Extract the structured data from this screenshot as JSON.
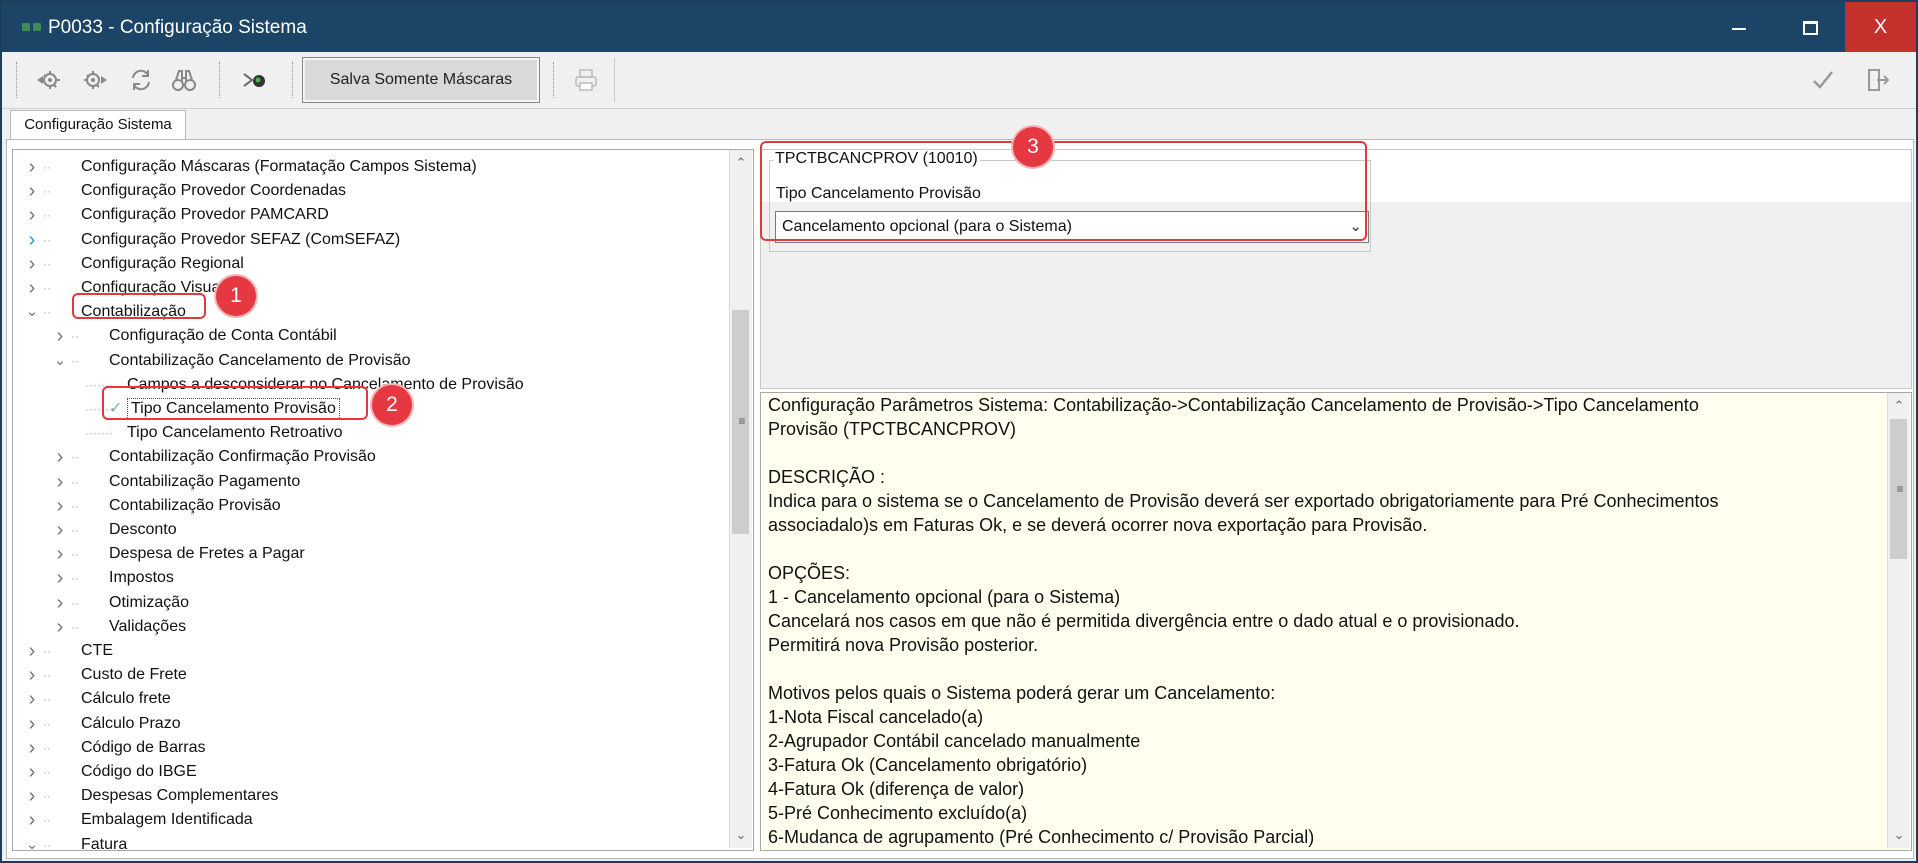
{
  "window": {
    "title": "P0033 - Configuração Sistema",
    "minimize_label": "—",
    "close_label": "X"
  },
  "toolbar": {
    "save_masks_label": "Salva Somente Máscaras"
  },
  "tab": {
    "label": "Configuração Sistema"
  },
  "tree": {
    "rows": [
      {
        "label": "Configuração Máscaras (Formatação Campos Sistema)",
        "level": 0,
        "expander": "collapsed"
      },
      {
        "label": "Configuração Provedor Coordenadas",
        "level": 0,
        "expander": "collapsed"
      },
      {
        "label": "Configuração Provedor PAMCARD",
        "level": 0,
        "expander": "collapsed"
      },
      {
        "label": "Configuração Provedor SEFAZ (ComSEFAZ)",
        "level": 0,
        "expander": "collapsed-blue"
      },
      {
        "label": "Configuração Regional",
        "level": 0,
        "expander": "collapsed"
      },
      {
        "label": "Configuração Visual",
        "level": 0,
        "expander": "collapsed"
      },
      {
        "label": "Contabilização",
        "level": 0,
        "expander": "expanded"
      },
      {
        "label": "Configuração de Conta Contábil",
        "level": 1,
        "expander": "collapsed"
      },
      {
        "label": "Contabilização Cancelamento de Provisão",
        "level": 1,
        "expander": "expanded"
      },
      {
        "label": "Campos a desconsiderar no Cancelamento de Provisão",
        "level": 2,
        "expander": "leaf"
      },
      {
        "label": "Tipo Cancelamento Provisão",
        "level": 2,
        "expander": "leaf-selected"
      },
      {
        "label": "Tipo Cancelamento Retroativo",
        "level": 2,
        "expander": "leaf"
      },
      {
        "label": "Contabilização Confirmação Provisão",
        "level": 1,
        "expander": "collapsed"
      },
      {
        "label": "Contabilização Pagamento",
        "level": 1,
        "expander": "collapsed"
      },
      {
        "label": "Contabilização Provisão",
        "level": 1,
        "expander": "collapsed"
      },
      {
        "label": "Desconto",
        "level": 1,
        "expander": "collapsed"
      },
      {
        "label": "Despesa de Fretes a Pagar",
        "level": 1,
        "expander": "collapsed"
      },
      {
        "label": "Impostos",
        "level": 1,
        "expander": "collapsed"
      },
      {
        "label": "Otimização",
        "level": 1,
        "expander": "collapsed"
      },
      {
        "label": "Validações",
        "level": 1,
        "expander": "collapsed"
      },
      {
        "label": "CTE",
        "level": 0,
        "expander": "collapsed"
      },
      {
        "label": "Custo de Frete",
        "level": 0,
        "expander": "collapsed"
      },
      {
        "label": "Cálculo frete",
        "level": 0,
        "expander": "collapsed"
      },
      {
        "label": "Cálculo Prazo",
        "level": 0,
        "expander": "collapsed"
      },
      {
        "label": "Código de Barras",
        "level": 0,
        "expander": "collapsed"
      },
      {
        "label": "Código do IBGE",
        "level": 0,
        "expander": "collapsed"
      },
      {
        "label": "Despesas Complementares",
        "level": 0,
        "expander": "collapsed"
      },
      {
        "label": "Embalagem Identificada",
        "level": 0,
        "expander": "collapsed"
      },
      {
        "label": "Fatura",
        "level": 0,
        "expander": "expanded"
      }
    ]
  },
  "annotations": {
    "badge1": "1",
    "badge2": "2",
    "badge3": "3"
  },
  "param": {
    "code": "TPCTBCANCPROV (10010)",
    "label": "Tipo Cancelamento Provisão",
    "selected_value": "Cancelamento opcional (para o Sistema)"
  },
  "description": {
    "lines": [
      "Configuração Parâmetros Sistema: Contabilização->Contabilização Cancelamento de Provisão->Tipo Cancelamento",
      "Provisão (TPCTBCANCPROV)",
      "",
      "DESCRIÇÃO :",
      "Indica para o sistema se o Cancelamento de Provisão deverá ser exportado obrigatoriamente para Pré Conhecimentos",
      "associadalo)s em Faturas Ok, e se deverá ocorrer nova exportação para Provisão.",
      "",
      "OPÇÕES:",
      "1 - Cancelamento opcional (para o Sistema)",
      "Cancelará nos casos em que não é permitida divergência entre o dado atual e o provisionado.",
      "Permitirá nova Provisão posterior.",
      "",
      "Motivos pelos quais o Sistema poderá gerar um Cancelamento:",
      "1-Nota Fiscal cancelado(a)",
      "2-Agrupador Contábil cancelado manualmente",
      "3-Fatura Ok (Cancelamento obrigatório)",
      "4-Fatura Ok (diferença de valor)",
      "5-Pré Conhecimento excluído(a)",
      "6-Mudanca de agrupamento (Pré Conhecimento c/ Provisão Parcial)"
    ]
  },
  "colors": {
    "titlebar": "#1c4466",
    "close": "#c4302b",
    "highlight": "#e0393f",
    "description_bg": "#fffeef"
  }
}
